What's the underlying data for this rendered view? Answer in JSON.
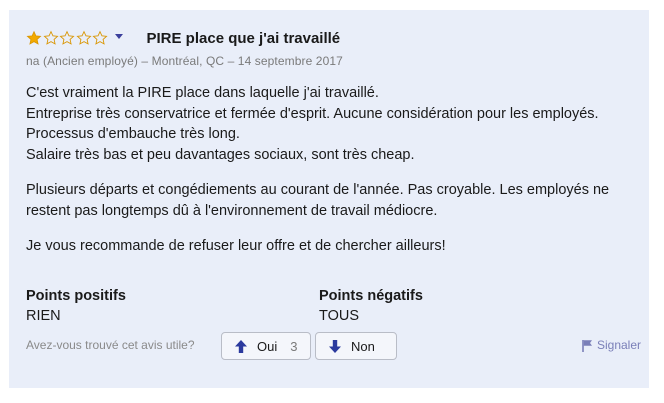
{
  "review": {
    "rating": 1,
    "rating_max": 5,
    "star_color": "#f2a900",
    "title": "PIRE place que j'ai travaillé",
    "meta": "na (Ancien employé) –  Montréal, QC – 14 septembre 2017",
    "body": [
      "C'est vraiment la PIRE place dans laquelle j'ai travaillé.",
      "Entreprise très conservatrice et fermée d'esprit. Aucune considération pour les employés.",
      "Processus d'embauche très long.",
      "Salaire très bas et peu davantages sociaux, sont très cheap.",
      "Plusieurs départs et congédiements au courant de l'année. Pas croyable. Les employés ne restent pas longtemps dû à l'environnement de travail médiocre.",
      "Je vous recommande de refuser leur offre et de chercher ailleurs!"
    ],
    "pros": {
      "heading": "Points positifs",
      "value": "RIEN"
    },
    "cons": {
      "heading": "Points négatifs",
      "value": "TOUS"
    },
    "helpful": {
      "question": "Avez-vous trouvé cet avis utile?",
      "yes_label": "Oui",
      "yes_count": "3",
      "no_label": "Non",
      "report_label": "Signaler"
    }
  }
}
